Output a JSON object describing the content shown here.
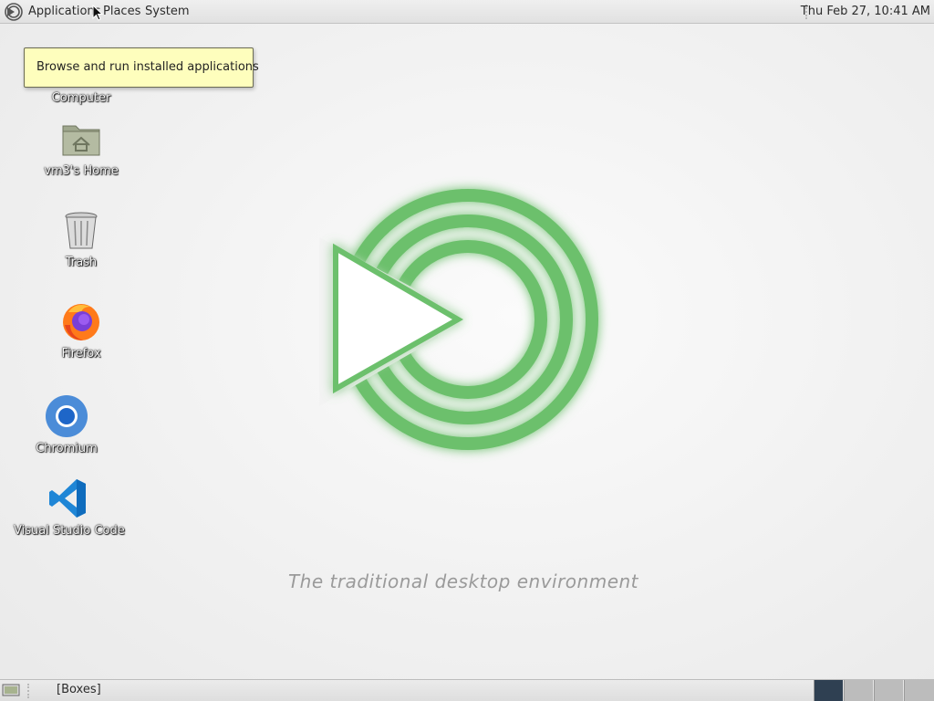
{
  "top_panel": {
    "menus": [
      "Applications",
      "Places",
      "System"
    ],
    "clock": "Thu Feb 27, 10:41 AM"
  },
  "tooltip": "Browse and run installed applications",
  "desktop_icons": [
    {
      "label": "Computer",
      "icon": "computer-icon"
    },
    {
      "label": "vm3's Home",
      "icon": "home-folder-icon"
    },
    {
      "label": "Trash",
      "icon": "trash-icon"
    },
    {
      "label": "Firefox",
      "icon": "firefox-icon"
    },
    {
      "label": "Chromium",
      "icon": "chromium-icon"
    },
    {
      "label": "Visual Studio Code",
      "icon": "vscode-icon"
    }
  ],
  "wallpaper": {
    "tagline": "The traditional desktop environment",
    "logo_color": "#6cc06c"
  },
  "bottom_panel": {
    "tasks": [
      "[Boxes]"
    ],
    "active_workspace": 1,
    "workspace_count": 4,
    "active_workspace_color": "#2f4052"
  }
}
